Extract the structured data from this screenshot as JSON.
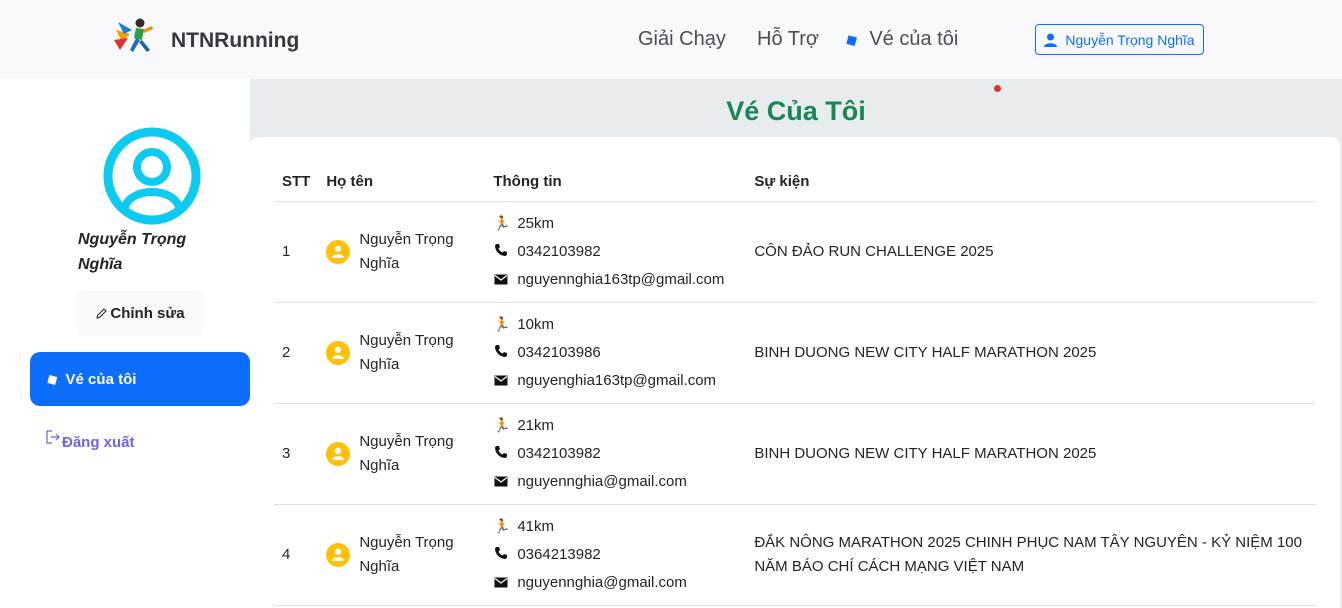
{
  "header": {
    "brand": "NTNRunning",
    "nav": {
      "races": "Giải Chạy",
      "support": "Hỗ Trợ",
      "my_tickets": "Vé của tôi"
    },
    "user_button": "Nguyễn Trọng Nghĩa"
  },
  "sidebar": {
    "name": "Nguyễn Trọng Nghĩa",
    "edit_label": "Chỉnh sửa",
    "active_item": "Vé của tôi",
    "logout_label": "Đăng xuất"
  },
  "main": {
    "title": "Vé Của Tôi",
    "columns": {
      "stt": "STT",
      "name": "Họ tên",
      "info": "Thông tin",
      "event": "Sự kiện"
    },
    "rows": [
      {
        "stt": "1",
        "name": "Nguyễn Trọng Nghĩa",
        "distance": "25km",
        "phone": "0342103982",
        "email": "nguyennghia163tp@gmail.com",
        "event": "CÔN ĐẢO RUN CHALLENGE 2025"
      },
      {
        "stt": "2",
        "name": "Nguyễn Trọng Nghĩa",
        "distance": "10km",
        "phone": "0342103986",
        "email": "nguyenghia163tp@gmail.com",
        "event": "BINH DUONG NEW CITY HALF MARATHON 2025"
      },
      {
        "stt": "3",
        "name": "Nguyễn Trọng Nghĩa",
        "distance": "21km",
        "phone": "0342103982",
        "email": "nguyennghia@gmail.com",
        "event": "BINH DUONG NEW CITY HALF MARATHON 2025"
      },
      {
        "stt": "4",
        "name": "Nguyễn Trọng Nghĩa",
        "distance": "41km",
        "phone": "0364213982",
        "email": "nguyennghia@gmail.com",
        "event": "ĐẮK NÔNG MARATHON 2025 CHINH PHỤC NAM TÂY NGUYÊN - KỶ NIỆM 100 NĂM BÁO CHÍ CÁCH MẠNG VIỆT NAM"
      }
    ]
  },
  "colors": {
    "primary": "#0d6efd",
    "title_green": "#198754",
    "avatar_cyan": "#0dcaf0",
    "user_icon_yellow": "#ffc107",
    "logout_purple": "#6f63e6"
  }
}
